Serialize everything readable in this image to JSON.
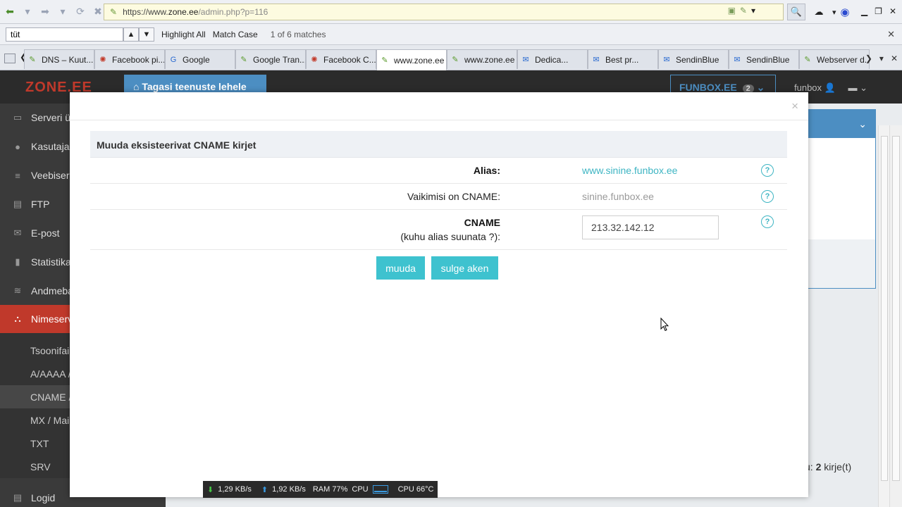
{
  "browser": {
    "url_prefix": "https://www.",
    "url_host": "zone.ee",
    "url_path": "/admin.php?p=116",
    "find": {
      "value": "tüt",
      "highlight_all": "Highlight All",
      "match_case": "Match Case",
      "matches": "1 of 6 matches"
    },
    "tabs": [
      {
        "label": "DNS – Kuut...",
        "icon": "page-icon",
        "active": false
      },
      {
        "label": "Facebook pi...",
        "icon": "spider-icon",
        "active": false
      },
      {
        "label": "Google",
        "icon": "google-icon",
        "active": false
      },
      {
        "label": "Google Tran...",
        "icon": "page-icon",
        "active": false
      },
      {
        "label": "Facebook C...",
        "icon": "spider-icon",
        "active": false
      },
      {
        "label": "www.zone.ee",
        "icon": "page-icon",
        "active": true
      },
      {
        "label": "www.zone.ee",
        "icon": "page-icon",
        "active": false
      },
      {
        "label": "Dedica...",
        "icon": "mail-icon",
        "active": false
      },
      {
        "label": "Best pr...",
        "icon": "mail-icon",
        "active": false
      },
      {
        "label": "SendinBlue",
        "icon": "mail-icon",
        "active": false
      },
      {
        "label": "SendinBlue",
        "icon": "mail-icon",
        "active": false
      },
      {
        "label": "Webserver d...",
        "icon": "page-icon",
        "active": false
      }
    ]
  },
  "page": {
    "logo": "ZONE.EE",
    "back_button": "Tagasi teenuste lehele",
    "account": "FUNBOX.EE",
    "account_count": "2",
    "username": "funbox",
    "records_total_prefix": "u: ",
    "records_total_count": "2",
    "records_total_suffix": " kirje(t)",
    "sidebar": {
      "items": [
        {
          "label": "Serveri ü"
        },
        {
          "label": "Kasutaja"
        },
        {
          "label": "Veebiser"
        },
        {
          "label": "FTP"
        },
        {
          "label": "E-post"
        },
        {
          "label": "Statistika"
        },
        {
          "label": "Andmeba"
        },
        {
          "label": "Nimeserv"
        }
      ],
      "subitems": [
        {
          "label": "Tsoonifai"
        },
        {
          "label": "A/AAAA /"
        },
        {
          "label": "CNAME /"
        },
        {
          "label": "MX / Mail"
        },
        {
          "label": "TXT"
        },
        {
          "label": "SRV"
        }
      ],
      "bottom_item": "Logid"
    }
  },
  "modal": {
    "close": "×",
    "form_title": "Muuda eksisteerivat CNAME kirjet",
    "alias_label": "Alias:",
    "alias_value": "www.sinine.funbox.ee",
    "default_label": "Vaikimisi on CNAME:",
    "default_value": "sinine.funbox.ee",
    "cname_label": "CNAME",
    "cname_sublabel": "(kuhu alias suunata ?):",
    "cname_value": "213.32.142.12",
    "help": "?",
    "submit_button": "muuda",
    "close_button": "sulge aken"
  },
  "statusbar": {
    "download": "1,29 KB/s",
    "upload": "1,92 KB/s",
    "ram": "RAM 77%",
    "cpu_label": "CPU",
    "cpu_temp": "CPU 66°C"
  },
  "colors": {
    "accent": "#3ec2cf",
    "link": "#3eb5c3",
    "page_blue": "#4c8ec2",
    "active_red": "#c0392b"
  }
}
